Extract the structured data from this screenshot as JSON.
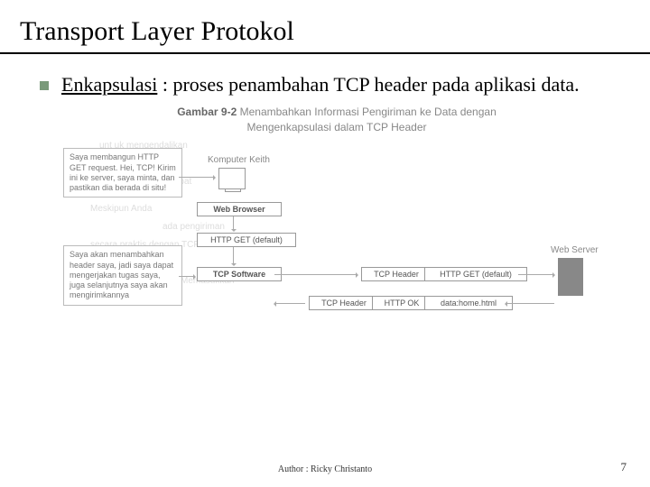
{
  "title": "Transport Layer Protokol",
  "bullet": {
    "text_html": "<u>Enkapsulasi</u> : proses penambahan TCP header pada aplikasi data."
  },
  "figure": {
    "caption_prefix": "Gambar 9-2",
    "caption_line1": "Menambahkan Informasi Pengiriman ke Data dengan",
    "caption_line2": "Mengenkapsulasi dalam TCP Header",
    "callout1": "Saya membangun HTTP GET request. Hei, TCP! Kirim ini ke server, saya minta, dan pastikan dia berada di situ!",
    "callout2": "Saya akan menambahkan header saya, jadi saya dapat mengerjakan tugas saya, juga selanjutnya saya akan mengirimkannya",
    "label_computer": "Komputer Keith",
    "label_browser": "Web Browser",
    "label_tcp_sw": "TCP Software",
    "label_webserver": "Web Server",
    "box_http_get": "HTTP GET (default)",
    "box_tcp_header": "TCP Header",
    "box_http_get2": "HTTP GET (default)",
    "box_http_ok": "HTTP OK",
    "box_data": "data:home.html"
  },
  "ghost_text": {
    "l1": "unt uk mengendalikan",
    "l2": "ke destinasi yang tepat",
    "l3": "Meskipun Anda",
    "l4": "ada pengiriman",
    "l5": "secara praktis dengan TCP",
    "l6": "Memasukkan"
  },
  "footer": {
    "author": "Author : Ricky Christanto",
    "page": "7"
  }
}
